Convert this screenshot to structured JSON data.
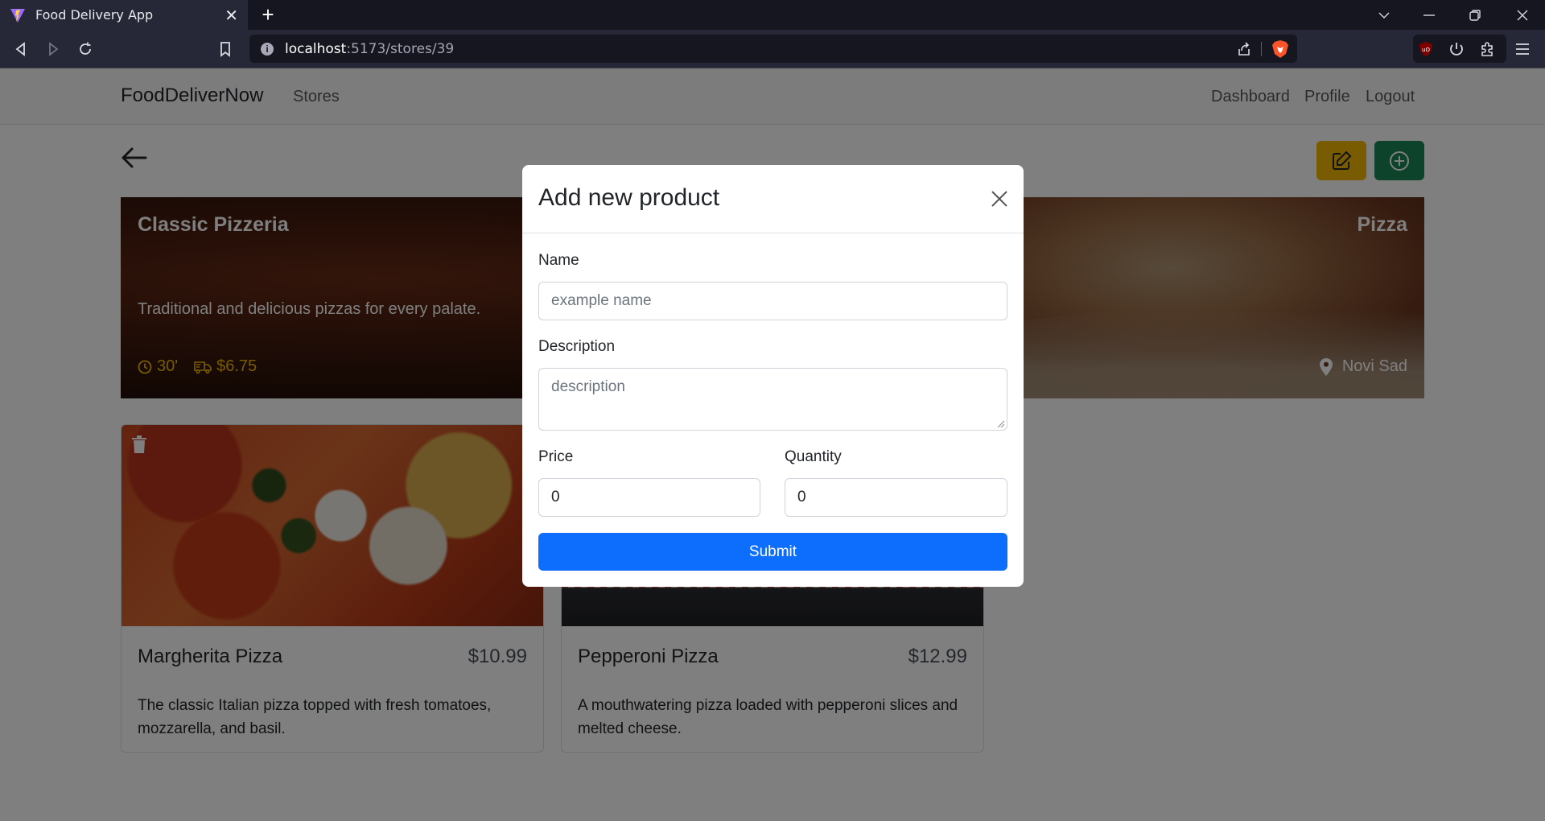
{
  "browser": {
    "tab_title": "Food Delivery App",
    "tab_close": "✕",
    "new_tab": "+",
    "url_host": "localhost",
    "url_path": ":5173/stores/39",
    "info_glyph": "i"
  },
  "navbar": {
    "brand": "FoodDeliverNow",
    "links_left": [
      "Stores"
    ],
    "links_right": [
      "Dashboard",
      "Profile",
      "Logout"
    ]
  },
  "store": {
    "name": "Classic Pizzeria",
    "category": "Pizza",
    "description": "Traditional and delicious pizzas for every palate.",
    "delivery_time": "30'",
    "delivery_fee": "$6.75",
    "location": "Novi Sad"
  },
  "products": [
    {
      "name": "Margherita Pizza",
      "price": "$10.99",
      "description": "The classic Italian pizza topped with fresh tomatoes, mozzarella, and basil."
    },
    {
      "name": "Pepperoni Pizza",
      "price": "$12.99",
      "description": "A mouthwatering pizza loaded with pepperoni slices and melted cheese."
    }
  ],
  "modal": {
    "title": "Add new product",
    "name_label": "Name",
    "name_placeholder": "example name",
    "description_label": "Description",
    "description_placeholder": "description",
    "price_label": "Price",
    "price_value": "0",
    "quantity_label": "Quantity",
    "quantity_value": "0",
    "submit_label": "Submit"
  },
  "colors": {
    "edit_button": "#f2b705",
    "add_button": "#198754",
    "submit_button": "#0d6efd",
    "accent_meta": "#f2b705"
  },
  "icons": [
    "back-arrow-icon",
    "edit-icon",
    "plus-circle-icon",
    "clock-icon",
    "truck-icon",
    "location-pin-icon",
    "trash-icon",
    "close-icon"
  ]
}
